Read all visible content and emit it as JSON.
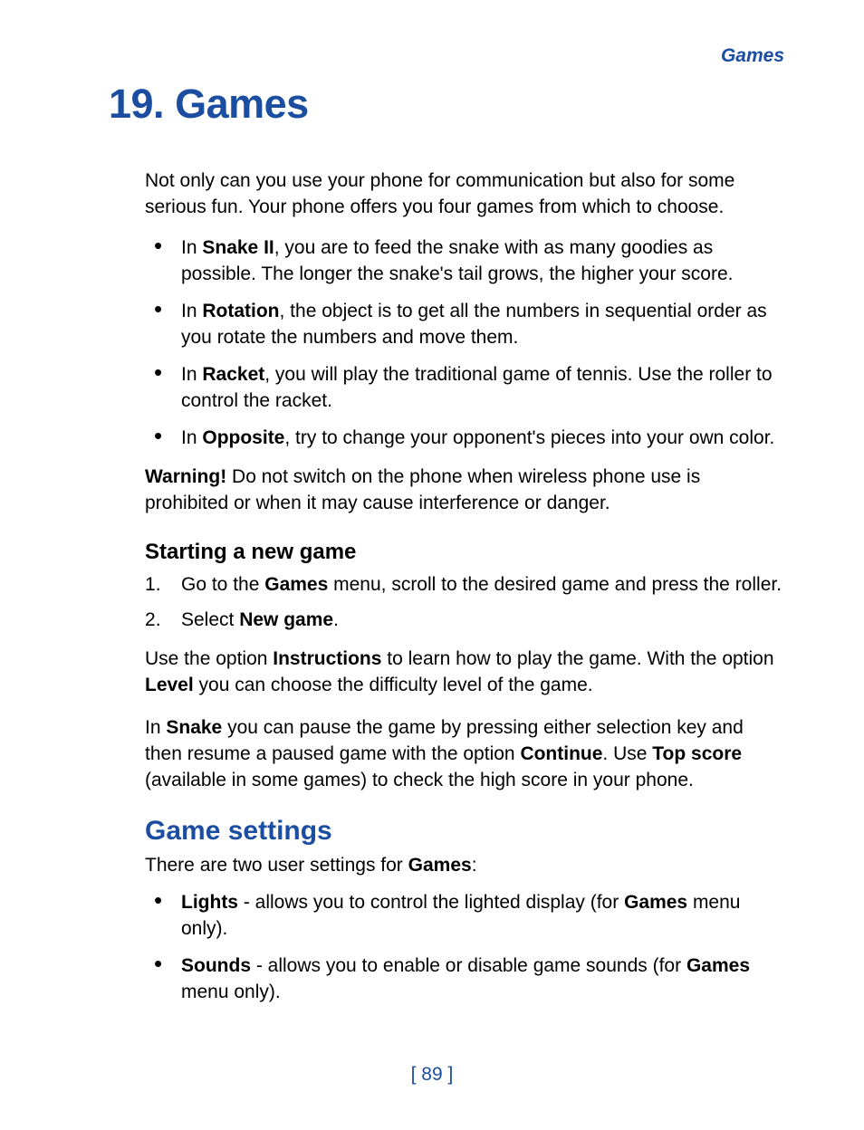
{
  "header": {
    "running": "Games"
  },
  "chapter": {
    "number": "19.",
    "title": "Games"
  },
  "intro": "Not only can you use your phone for communication but also for some serious fun. Your phone offers you four games from which to choose.",
  "games": [
    {
      "pre": "In ",
      "name": "Snake II",
      "desc": ", you are to feed the snake with as many goodies as possible. The longer the snake's tail grows, the higher your score."
    },
    {
      "pre": "In ",
      "name": "Rotation",
      "desc": ", the object is to get all the numbers in sequential order as you rotate the numbers and move them."
    },
    {
      "pre": "In ",
      "name": "Racket",
      "desc": ", you will play the traditional game of tennis. Use the roller to control the racket."
    },
    {
      "pre": "In ",
      "name": "Opposite",
      "desc": ", try to change your opponent's pieces into your own color."
    }
  ],
  "warning": {
    "label": "Warning!",
    "text": "  Do not switch on the phone when wireless phone use is prohibited or when it may cause interference or danger."
  },
  "starting": {
    "heading": "Starting a new game",
    "steps": [
      {
        "a": "Go to the ",
        "b": "Games",
        "c": " menu, scroll to the desired game and press the roller."
      },
      {
        "a": "Select ",
        "b": "New game",
        "c": "."
      }
    ],
    "p1": {
      "a": "Use the option ",
      "b": "Instructions",
      "c": " to learn how to play the game. With the option ",
      "d": "Level",
      "e": " you can choose the difficulty level of the game."
    },
    "p2": {
      "a": "In ",
      "b": "Snake",
      "c": " you can pause the game by pressing either selection key and then resume a paused game with the option ",
      "d": "Continue",
      "e": ". Use ",
      "f": "Top score",
      "g": " (available in some games) to check the high score in your phone."
    }
  },
  "settings": {
    "heading": "Game settings",
    "intro": {
      "a": "There are two user settings for ",
      "b": "Games",
      "c": ":"
    },
    "items": [
      {
        "name": "Lights",
        "sep": " - ",
        "desc_a": "allows you to control the lighted display (for ",
        "desc_b": "Games",
        "desc_c": " menu only)."
      },
      {
        "name": "Sounds",
        "sep": " - ",
        "desc_a": "allows you to enable or disable game sounds (for ",
        "desc_b": "Games",
        "desc_c": " menu only)."
      }
    ]
  },
  "page_num": "[ 89 ]"
}
